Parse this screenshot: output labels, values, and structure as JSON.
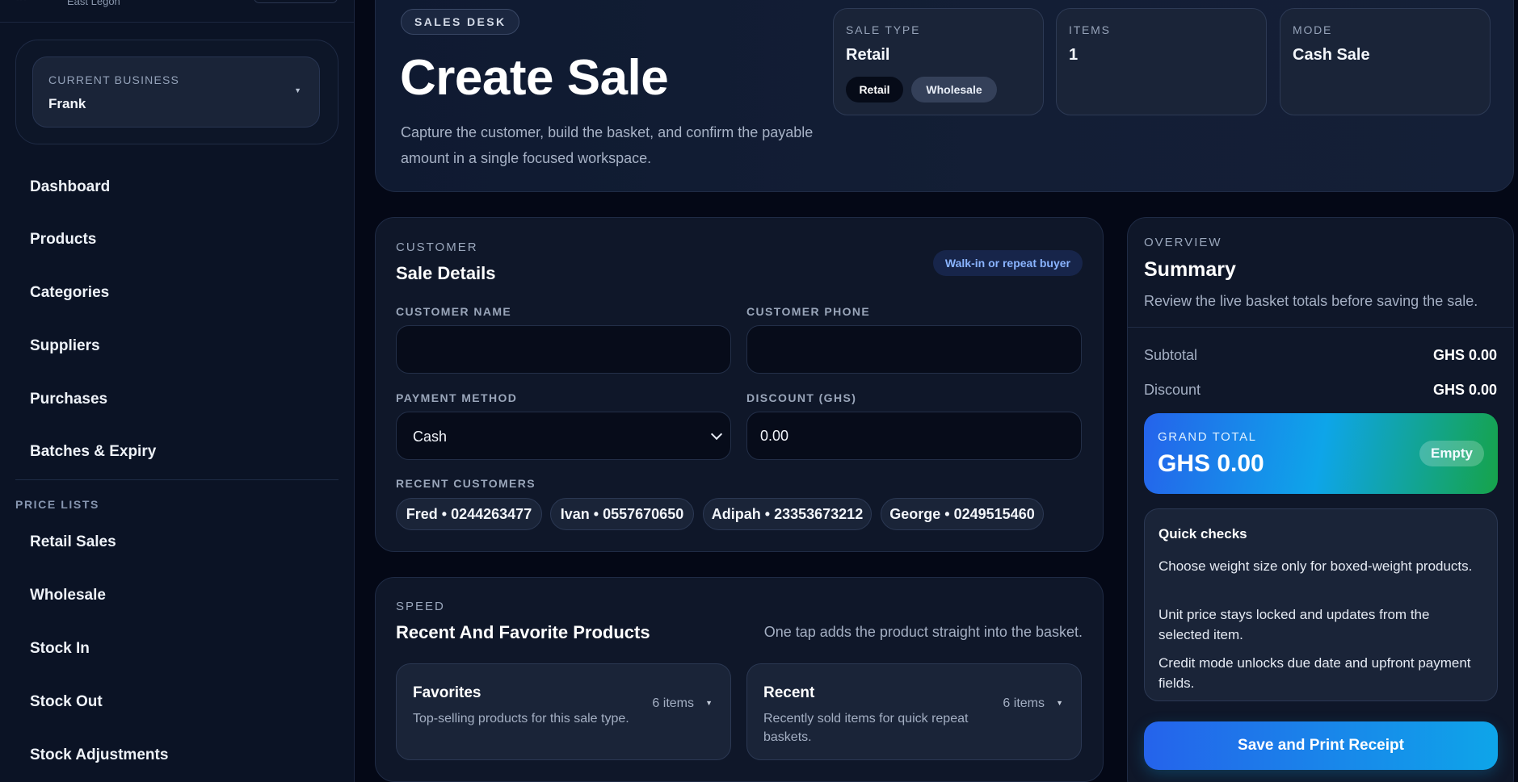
{
  "sidebar": {
    "brand_sub": "East Legon",
    "business": {
      "label": "CURRENT BUSINESS",
      "value": "Frank"
    },
    "nav": [
      {
        "label": "Dashboard"
      },
      {
        "label": "Products"
      },
      {
        "label": "Categories"
      },
      {
        "label": "Suppliers"
      },
      {
        "label": "Purchases"
      },
      {
        "label": "Batches & Expiry"
      }
    ],
    "price_section": "PRICE LISTS",
    "price_nav": [
      {
        "label": "Retail Sales"
      },
      {
        "label": "Wholesale"
      },
      {
        "label": "Stock In"
      },
      {
        "label": "Stock Out"
      },
      {
        "label": "Stock Adjustments"
      }
    ]
  },
  "header": {
    "tag": "SALES DESK",
    "title": "Create Sale",
    "description": "Capture the customer, build the basket, and confirm the payable amount in a single focused workspace.",
    "stats": {
      "sale_type": {
        "label": "SALE TYPE",
        "value": "Retail",
        "options": [
          "Retail",
          "Wholesale"
        ]
      },
      "items": {
        "label": "ITEMS",
        "value": "1"
      },
      "mode": {
        "label": "MODE",
        "value": "Cash Sale"
      }
    }
  },
  "customer": {
    "kicker": "CUSTOMER",
    "title": "Sale Details",
    "badge": "Walk-in or repeat buyer",
    "name_label": "CUSTOMER NAME",
    "name_value": "",
    "phone_label": "CUSTOMER PHONE",
    "phone_value": "",
    "payment_label": "PAYMENT METHOD",
    "payment_value": "Cash",
    "discount_label": "DISCOUNT (GHS)",
    "discount_value": "0.00",
    "recent_label": "RECENT CUSTOMERS",
    "recent": [
      "Fred • 0244263477",
      "Ivan • 0557670650",
      "Adipah • 23353673212",
      "George • 0249515460"
    ]
  },
  "speed": {
    "kicker": "SPEED",
    "title": "Recent And Favorite Products",
    "note": "One tap adds the product straight into the basket.",
    "favorites": {
      "title": "Favorites",
      "desc": "Top-selling products for this sale type.",
      "count": "6 items"
    },
    "recent": {
      "title": "Recent",
      "desc": "Recently sold items for quick repeat baskets.",
      "count": "6 items"
    }
  },
  "summary": {
    "kicker": "OVERVIEW",
    "title": "Summary",
    "desc": "Review the live basket totals before saving the sale.",
    "subtotal_label": "Subtotal",
    "subtotal_value": "GHS 0.00",
    "discount_label": "Discount",
    "discount_value": "GHS 0.00",
    "grand_label": "GRAND TOTAL",
    "grand_value": "GHS 0.00",
    "grand_badge": "Empty",
    "checks_title": "Quick checks",
    "checks": [
      "Choose weight size only for boxed-weight products.",
      "Unit price stays locked and updates from the selected item.",
      "Credit mode unlocks due date and upfront payment fields."
    ],
    "save_label": "Save and Print Receipt"
  },
  "colors": {
    "accent_blue": "#2563eb",
    "accent_cyan": "#0ea5e9",
    "accent_green": "#16a34a",
    "background": "#040816"
  }
}
